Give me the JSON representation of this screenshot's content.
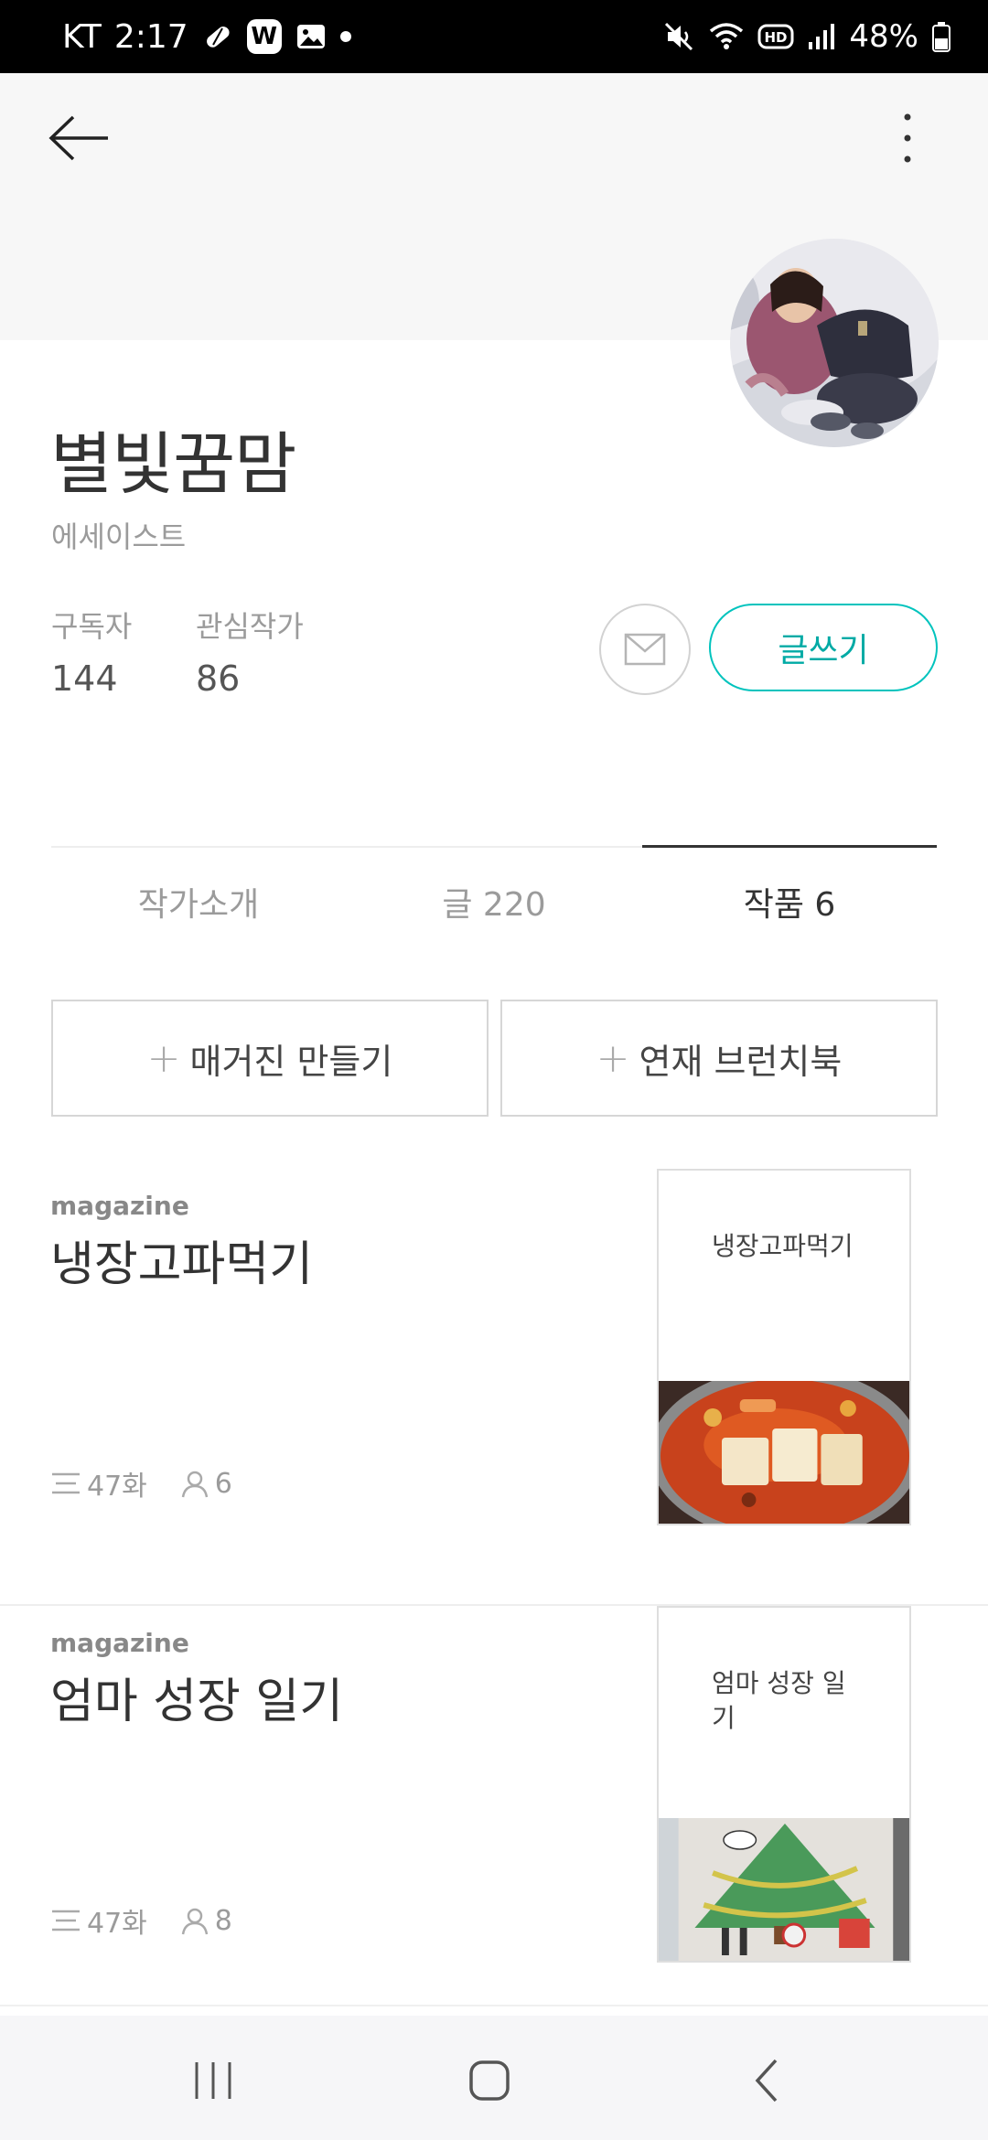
{
  "status_bar": {
    "carrier": "KT",
    "time": "2:17",
    "battery": "48%",
    "icons": [
      "pill-icon",
      "w-app-icon",
      "image-icon",
      "dot-icon",
      "mute-icon",
      "wifi-icon",
      "hd-icon",
      "signal-icon",
      "battery-icon"
    ],
    "w_badge": "W"
  },
  "profile": {
    "name": "별빛꿈맘",
    "role": "에세이스트",
    "subscribers_label": "구독자",
    "subscribers_value": "144",
    "following_label": "관심작가",
    "following_value": "86",
    "write_label": "글쓰기"
  },
  "tabs": [
    {
      "label": "작가소개",
      "active": false
    },
    {
      "label": "글 220",
      "active": false
    },
    {
      "label": "작품 6",
      "active": true
    }
  ],
  "actions": {
    "make_magazine": "매거진 만들기",
    "serial_brunchbook": "연재 브런치북"
  },
  "magazines": [
    {
      "kind": "magazine",
      "title": "냉장고파먹기",
      "episodes": "47화",
      "subscribers": "6",
      "cover_title": "냉장고파먹기"
    },
    {
      "kind": "magazine",
      "title": "엄마 성장 일기",
      "episodes": "47화",
      "subscribers": "8",
      "cover_title": "엄마 성장 일기"
    }
  ],
  "colors": {
    "accent": "#00c3bd",
    "header_bg": "#f7f7f7",
    "nav_bg": "#f6f6f8"
  }
}
